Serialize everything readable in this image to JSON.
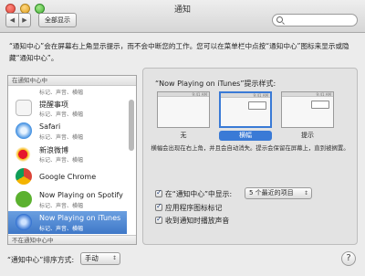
{
  "window": {
    "title": "通知"
  },
  "toolbar": {
    "back": "◀",
    "forward": "▶",
    "show_all": "全部显示"
  },
  "search": {
    "value": "",
    "placeholder": ""
  },
  "description": "“通知中心”会在屏幕右上角显示提示，而不会中断您的工作。您可以在菜单栏中点按“通知中心”图标来显示或隐藏“通知中心”。",
  "app_list": {
    "header": "在通知中心中",
    "footer": "不在通知中心中",
    "partial_sub": "标记、声音、横幅",
    "items": [
      {
        "name": "提醒事项",
        "sub": "标记、声音、横幅",
        "icon": "reminders-icon",
        "color": "#f5f5f5"
      },
      {
        "name": "Safari",
        "sub": "标记、声音、横幅",
        "icon": "safari-icon",
        "color": "#3a8be0"
      },
      {
        "name": "新浪微博",
        "sub": "标记、声音、横幅",
        "icon": "weibo-icon",
        "color": "#e6162d"
      },
      {
        "name": "Google Chrome",
        "sub": "",
        "icon": "chrome-icon",
        "color": "#4caf50"
      },
      {
        "name": "Now Playing on Spotify",
        "sub": "标记、声音、横幅",
        "icon": "spotify-icon",
        "color": "#5bb12f"
      },
      {
        "name": "Now Playing on iTunes",
        "sub": "标记、声音、横幅",
        "icon": "itunes-icon",
        "color": "#2f6fd0",
        "selected": true
      }
    ]
  },
  "detail": {
    "style_title": "“Now Playing on iTunes”提示样式:",
    "styles": [
      {
        "label": "无",
        "time": "9:41 AM"
      },
      {
        "label": "横幅",
        "time": "9:41 AM",
        "selected": true
      },
      {
        "label": "提示",
        "time": "9:41 AM"
      }
    ],
    "style_description": "横幅会出现在右上角，并且会自动消失。提示会保留在屏幕上，直到被搁置。",
    "options": {
      "show_in_center": "在“通知中心”中显示:",
      "show_in_center_value": "5 个最近的项目",
      "badge_icon": "应用程序图标标记",
      "play_sound": "收到通知时播放声音"
    }
  },
  "footer": {
    "sort_label": "“通知中心”排序方式:",
    "sort_value": "手动",
    "help": "?"
  }
}
